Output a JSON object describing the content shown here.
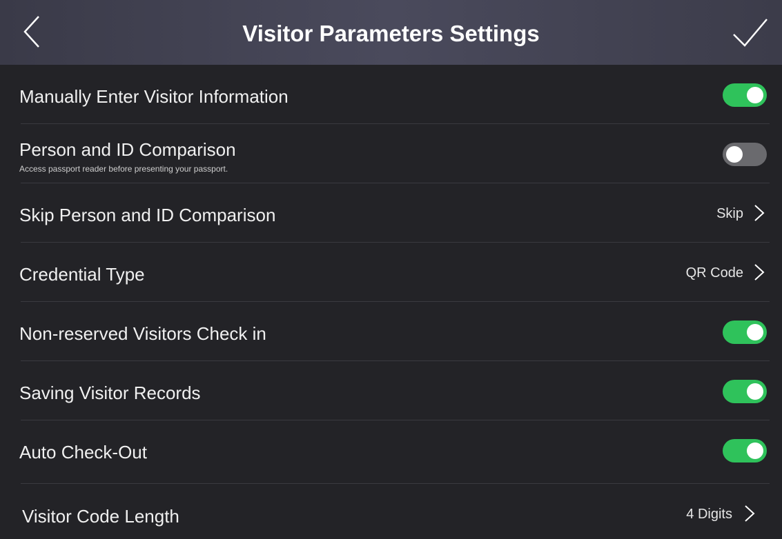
{
  "header": {
    "title": "Visitor Parameters Settings",
    "back_icon": "chevron-left-icon",
    "confirm_icon": "checkmark-icon"
  },
  "colors": {
    "toggle_on": "#2fc25b",
    "toggle_off": "#6a6a6e",
    "background": "#232327"
  },
  "settings": [
    {
      "label": "Manually Enter Visitor Information",
      "type": "toggle",
      "enabled": true
    },
    {
      "label": "Person and ID Comparison",
      "sublabel": "Access passport reader before presenting your passport.",
      "type": "toggle",
      "enabled": false
    },
    {
      "label": "Skip Person and ID Comparison",
      "type": "select",
      "value": "Skip"
    },
    {
      "label": "Credential Type",
      "type": "select",
      "value": "QR Code"
    },
    {
      "label": "Non-reserved Visitors Check in",
      "type": "toggle",
      "enabled": true
    },
    {
      "label": "Saving Visitor Records",
      "type": "toggle",
      "enabled": true
    },
    {
      "label": "Auto Check-Out",
      "type": "toggle",
      "enabled": true
    },
    {
      "label": "Visitor Code Length",
      "type": "select",
      "value": "4 Digits"
    }
  ]
}
